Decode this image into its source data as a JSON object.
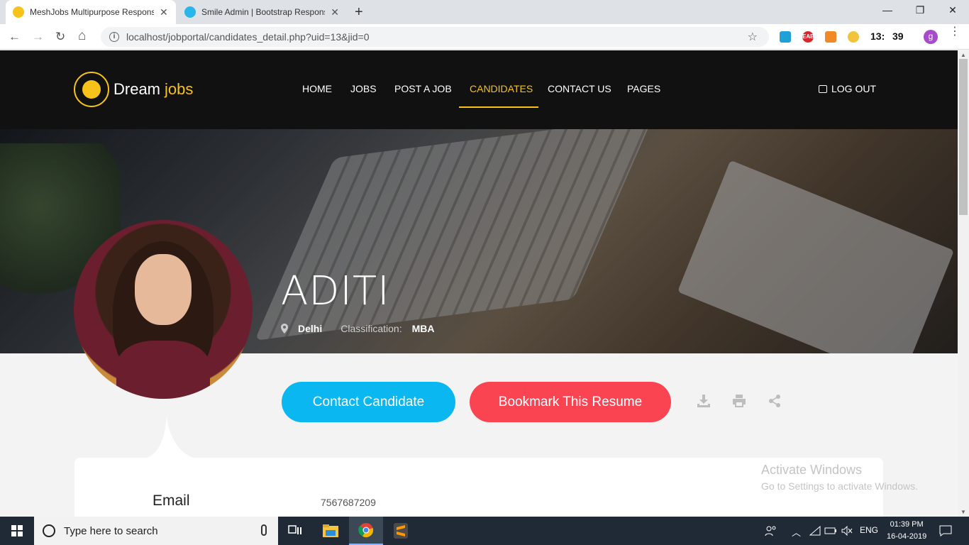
{
  "browser": {
    "tabs": [
      {
        "title": "MeshJobs Multipurpose Responsive",
        "favicon_color": "#f7c21a",
        "active": true
      },
      {
        "title": "Smile Admin | Bootstrap Responsive",
        "favicon_color": "#2bb6e8",
        "active": false
      }
    ],
    "close_glyph": "✕",
    "newtab_glyph": "+",
    "window_controls": {
      "minimize": "—",
      "maximize": "❐",
      "close": "✕"
    },
    "url": "localhost/jobportal/candidates_detail.php?uid=13&jid=0",
    "nav_glyphs": {
      "back": "←",
      "forward": "→",
      "reload": "↻",
      "home": "⌂",
      "info": "i",
      "bookmark_star": "☆",
      "menu": "⋮"
    },
    "extensions": [
      {
        "name": "ext-blue-icon",
        "color": "#1da1d6",
        "label": ""
      },
      {
        "name": "ext-eab-icon",
        "color": "#d9262c",
        "label": "EAB"
      },
      {
        "name": "ext-orange-icon",
        "color": "#f08a24",
        "label": ""
      },
      {
        "name": "ext-sun-icon",
        "color": "#f3c33b",
        "label": ""
      }
    ],
    "ext_clock": {
      "h": "13:",
      "m": "39"
    },
    "profile_initial": "g"
  },
  "site": {
    "logo": {
      "word1": "Dream",
      "word2": "jobs"
    },
    "nav": [
      {
        "label": "HOME",
        "active": false
      },
      {
        "label": "JOBS",
        "active": false
      },
      {
        "label": "POST A JOB",
        "active": false
      },
      {
        "label": "CANDIDATES",
        "active": true
      },
      {
        "label": "CONTACT US",
        "active": false
      },
      {
        "label": "PAGES",
        "active": false
      }
    ],
    "logout": "LOG OUT",
    "accent": "#f7c21a"
  },
  "candidate": {
    "name": "ADITI",
    "location": "Delhi",
    "classification_label": "Classification:",
    "classification": "MBA"
  },
  "actions": {
    "contact": "Contact Candidate",
    "bookmark": "Bookmark This Resume",
    "contact_color": "#0bb7f0",
    "bookmark_color": "#fb4452"
  },
  "details": {
    "email_label": "Email",
    "email_value": "7567687209"
  },
  "watermark": {
    "line1": "Activate Windows",
    "line2": "Go to Settings to activate Windows."
  },
  "taskbar": {
    "search_placeholder": "Type here to search",
    "language": "ENG",
    "time": "01:39 PM",
    "date": "16-04-2019"
  }
}
